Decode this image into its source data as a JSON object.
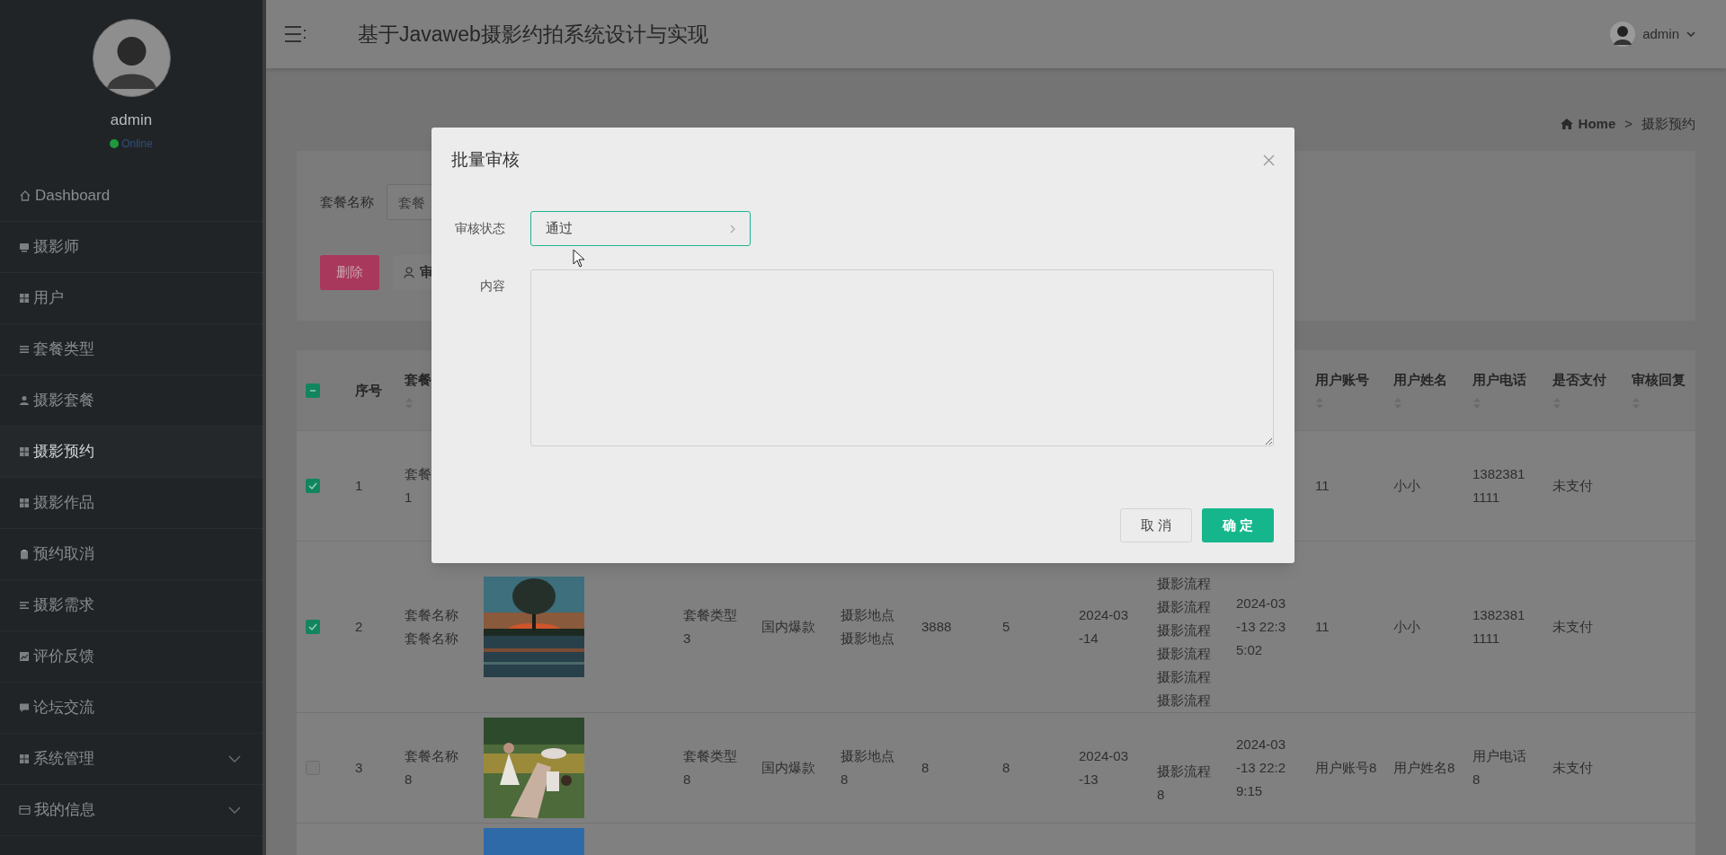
{
  "sidebar": {
    "user": {
      "name": "admin",
      "status": "Online"
    },
    "items": [
      {
        "label": "Dashboard",
        "kind": "link",
        "selected": false
      },
      {
        "label": "摄影师",
        "kind": "link",
        "selected": false
      },
      {
        "label": "用户",
        "kind": "link",
        "selected": false
      },
      {
        "label": "套餐类型",
        "kind": "link",
        "selected": false
      },
      {
        "label": "摄影套餐",
        "kind": "link",
        "selected": false
      },
      {
        "label": "摄影预约",
        "kind": "link",
        "selected": true
      },
      {
        "label": "摄影作品",
        "kind": "link",
        "selected": false
      },
      {
        "label": "预约取消",
        "kind": "link",
        "selected": false
      },
      {
        "label": "摄影需求",
        "kind": "link",
        "selected": false
      },
      {
        "label": "评价反馈",
        "kind": "link",
        "selected": false
      },
      {
        "label": "论坛交流",
        "kind": "link",
        "selected": false
      },
      {
        "label": "系统管理",
        "kind": "submenu",
        "expanded": false,
        "selected": false
      },
      {
        "label": "我的信息",
        "kind": "submenu",
        "expanded": false,
        "selected": false
      }
    ]
  },
  "header": {
    "title": "基于Javaweb摄影约拍系统设计与实现",
    "user": "admin"
  },
  "breadcrumb": {
    "items": [
      "Home",
      "摄影预约"
    ],
    "separator": ">"
  },
  "search": {
    "label": "套餐名称",
    "placeholder": "套餐"
  },
  "actions": [
    {
      "kind": "danger",
      "label": "删除"
    },
    {
      "kind": "default",
      "label": "审"
    }
  ],
  "table": {
    "select_all_partial": true,
    "headers": [
      {
        "label": "序号",
        "sortable": false
      },
      {
        "label": "套餐",
        "sortable": true
      },
      {
        "label": "用户账号",
        "sortable": true
      },
      {
        "label": "用户姓名",
        "sortable": true
      },
      {
        "label": "用户电话",
        "sortable": true
      },
      {
        "label": "是否支付",
        "sortable": true
      },
      {
        "label": "审核回复",
        "sortable": true
      }
    ],
    "rows": [
      {
        "selected": true,
        "index": "1",
        "package_name": "套餐\n1",
        "user_account": "11",
        "user_name": "小小",
        "user_phone": "13823811111",
        "payment": "未支付"
      },
      {
        "selected": true,
        "index": "2",
        "package_name": "套餐名称套餐名称",
        "image": {
          "kind": "picture"
        },
        "package_type": "套餐类型3",
        "column_6": "国内爆款",
        "location": "摄影地点摄影地点",
        "column_8": "3888",
        "column_9": "5",
        "column_10": "2024-03-14",
        "process": "摄影流程摄影流程摄影流程摄影流程摄影流程摄影流程",
        "column_12": "2024-03-13 22:35:02",
        "user_account": "11",
        "user_name": "小小",
        "user_phone": "13823811111",
        "payment": "未支付"
      },
      {
        "selected": false,
        "index": "3",
        "package_name": "套餐名称8",
        "image": {
          "kind": "picture"
        },
        "package_type": "套餐类型8",
        "column_6": "国内爆款",
        "location": "摄影地点8",
        "column_8": "8",
        "column_9": "8",
        "column_10": "2024-03-13",
        "process": "摄影流程8",
        "column_12": "2024-03-13 22:29:15",
        "user_account": "用户账号8",
        "user_name": "用户姓名8",
        "user_phone": "用户电话8",
        "payment": "未支付"
      },
      {
        "image": {
          "kind": "picture"
        }
      }
    ]
  },
  "modal": {
    "title": "批量审核",
    "fields": [
      {
        "kind": "select",
        "label": "审核状态",
        "value": "通过"
      },
      {
        "kind": "textarea",
        "label": "内容"
      }
    ],
    "buttons": [
      {
        "kind": "default",
        "label": "取 消"
      },
      {
        "kind": "primary",
        "label": "确 定"
      }
    ]
  }
}
